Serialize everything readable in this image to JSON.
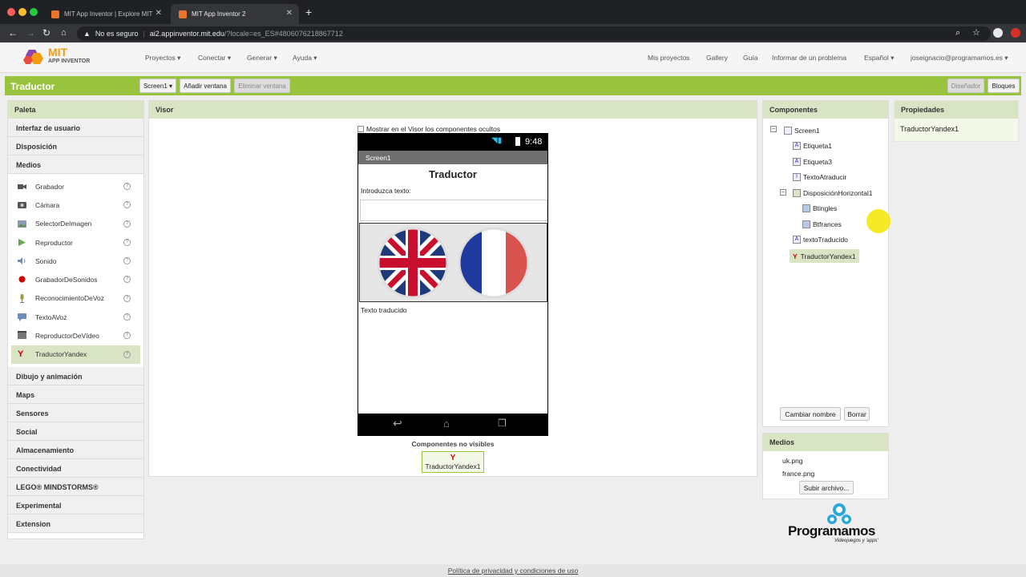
{
  "browser": {
    "tabs": [
      {
        "title": "MIT App Inventor | Explore MIT"
      },
      {
        "title": "MIT App Inventor 2"
      }
    ],
    "new_tab": "+",
    "security": "No es seguro",
    "url_host": "ai2.appinventor.mit.edu",
    "url_path": "/?locale=es_ES#4806076218867712"
  },
  "header": {
    "logo_top": "MIT",
    "logo_bottom": "APP INVENTOR",
    "menus": [
      "Proyectos ▾",
      "Conectar ▾",
      "Generar ▾",
      "Ayuda ▾"
    ],
    "right_links": [
      "Mis proyectos",
      "Gallery",
      "Guía",
      "Informar de un problema",
      "Español ▾",
      "joseignacio@programamos.es ▾"
    ]
  },
  "toolbar": {
    "project": "Traductor",
    "screen": "Screen1 ▾",
    "add_screen": "Añadir ventana",
    "remove_screen": "Eliminar ventana",
    "designer": "Diseñador",
    "blocks": "Bloques"
  },
  "palette": {
    "title": "Paleta",
    "top_categories": [
      "Interfaz de usuario",
      "Disposición",
      "Medios"
    ],
    "items": [
      {
        "label": "Grabador",
        "icon": "camcorder-icon"
      },
      {
        "label": "Cámara",
        "icon": "camera-icon"
      },
      {
        "label": "SelectorDeImagen",
        "icon": "image-picker-icon"
      },
      {
        "label": "Reproductor",
        "icon": "player-icon"
      },
      {
        "label": "Sonido",
        "icon": "sound-icon"
      },
      {
        "label": "GrabadorDeSonidos",
        "icon": "sound-recorder-icon"
      },
      {
        "label": "ReconocimientoDeVoz",
        "icon": "speech-recognizer-icon"
      },
      {
        "label": "TextoAVoz",
        "icon": "text-to-speech-icon"
      },
      {
        "label": "ReproductorDeVídeo",
        "icon": "video-player-icon"
      },
      {
        "label": "TraductorYandex",
        "icon": "yandex-icon"
      }
    ],
    "help": "?",
    "bottom_categories": [
      "Dibujo y animación",
      "Maps",
      "Sensores",
      "Social",
      "Almacenamiento",
      "Conectividad",
      "LEGO® MINDSTORMS®",
      "Experimental",
      "Extension"
    ]
  },
  "viewer": {
    "title": "Visor",
    "show_hidden": "Mostrar en el Visor los componentes ocultos",
    "time": "9:48",
    "screen_title": "Screen1",
    "app_title": "Traductor",
    "prompt": "Introduzca texto:",
    "translated": "Texto traducido",
    "nonvisible_title": "Componentes no visibles",
    "nonvisible_item": "TraductorYandex1"
  },
  "components": {
    "title": "Componentes",
    "tree": [
      "Screen1",
      "Etiqueta1",
      "Etiqueta3",
      "TextoAtraducir",
      "DisposiciónHorizontal1",
      "Btingles",
      "Btfrances",
      "textoTraducido",
      "TraductorYandex1"
    ],
    "rename": "Cambiar nombre",
    "delete": "Borrar"
  },
  "media": {
    "title": "Medios",
    "files": [
      "uk.png",
      "france.png"
    ],
    "upload": "Subir archivo..."
  },
  "properties": {
    "title": "Propiedades",
    "selected": "TraductorYandex1"
  },
  "watermark": {
    "brand": "Programamos",
    "tagline": "Videojuegos y 'apps'"
  },
  "footer": {
    "link": "Política de privacidad y condiciones de uso"
  },
  "colors": {
    "accent": "#99c33c",
    "panel_header": "#d9e4c5",
    "cursor_highlight": "#f5e500"
  }
}
